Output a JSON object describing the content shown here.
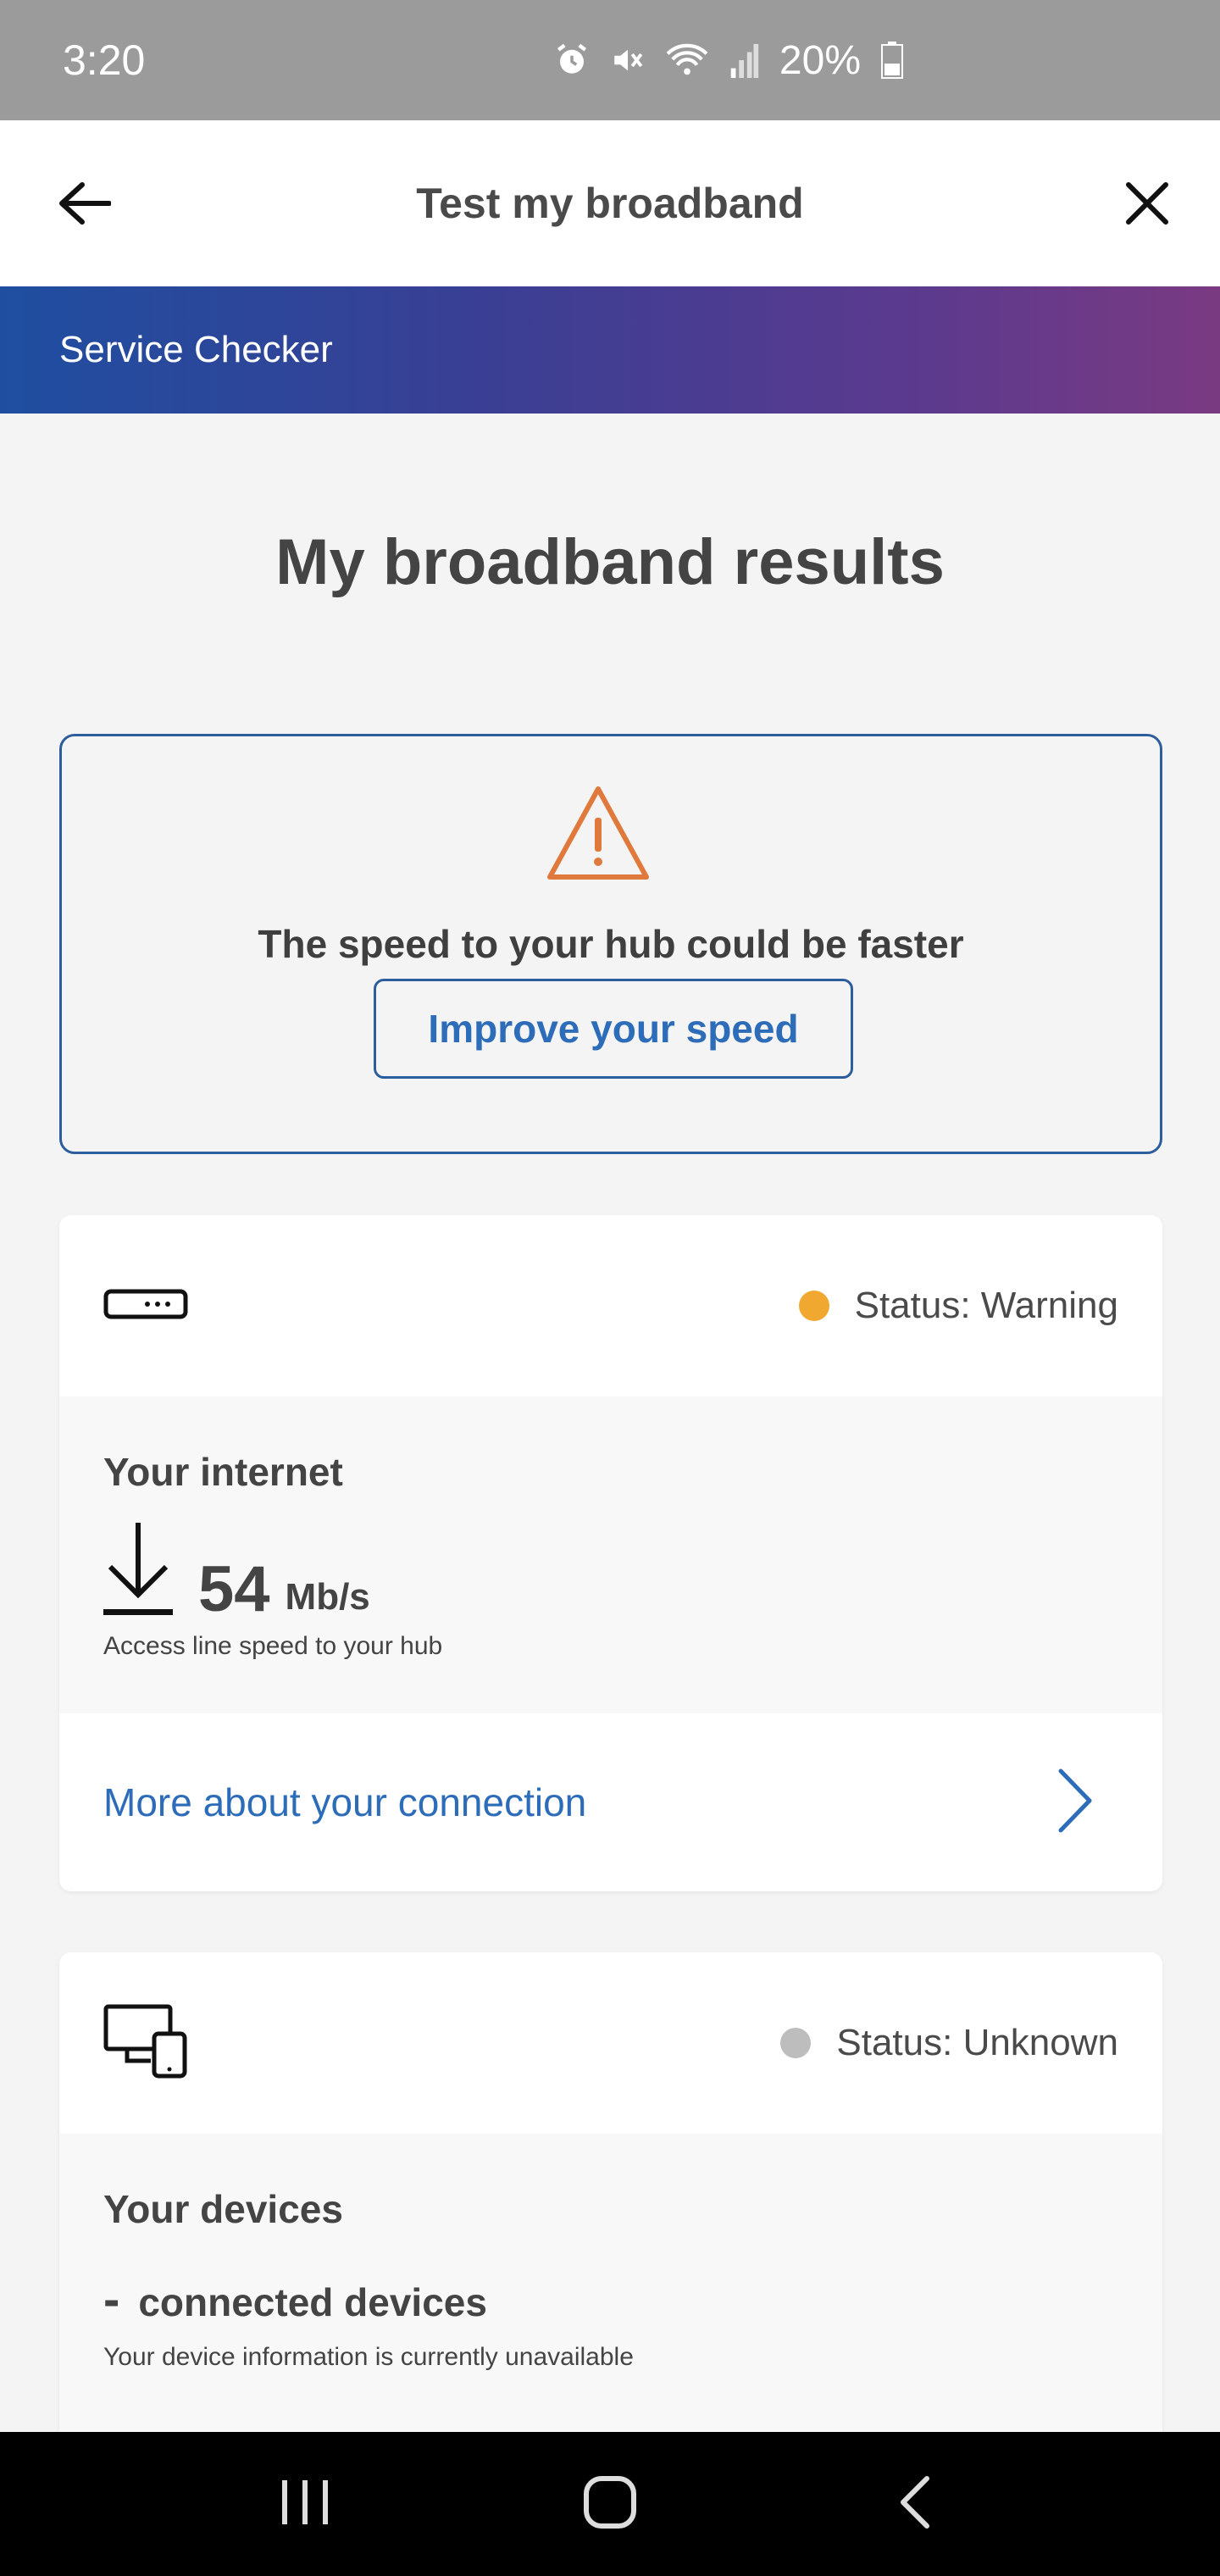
{
  "status_bar": {
    "time": "3:20",
    "battery": "20%",
    "icons": [
      "alarm-icon",
      "mute-icon",
      "wifi-icon",
      "signal-icon",
      "battery-icon"
    ]
  },
  "header": {
    "title": "Test my broadband",
    "back_icon": "arrow-left-icon",
    "close_icon": "close-icon"
  },
  "banner": {
    "label": "Service Checker"
  },
  "page": {
    "title": "My broadband results"
  },
  "alert": {
    "icon": "warning-triangle-icon",
    "message": "The speed to your hub could be faster",
    "button_label": "Improve your speed"
  },
  "internet_card": {
    "icon": "router-icon",
    "status_label": "Status: Warning",
    "status_color": "#f0a830",
    "heading": "Your internet",
    "speed_value": "54",
    "speed_unit": "Mb/s",
    "speed_caption": "Access line speed to your hub",
    "link_label": "More about your connection"
  },
  "devices_card": {
    "icon": "devices-icon",
    "status_label": "Status: Unknown",
    "status_color": "#bdbdbd",
    "heading": "Your devices",
    "count_value": "-",
    "count_label": "connected devices",
    "caption": "Your device information is currently unavailable"
  },
  "nav": {
    "items": [
      "recent-apps-icon",
      "home-icon",
      "back-icon"
    ]
  },
  "colors": {
    "accent": "#2c6cb8",
    "border": "#2c5d9c",
    "warning": "#e07a3c"
  }
}
